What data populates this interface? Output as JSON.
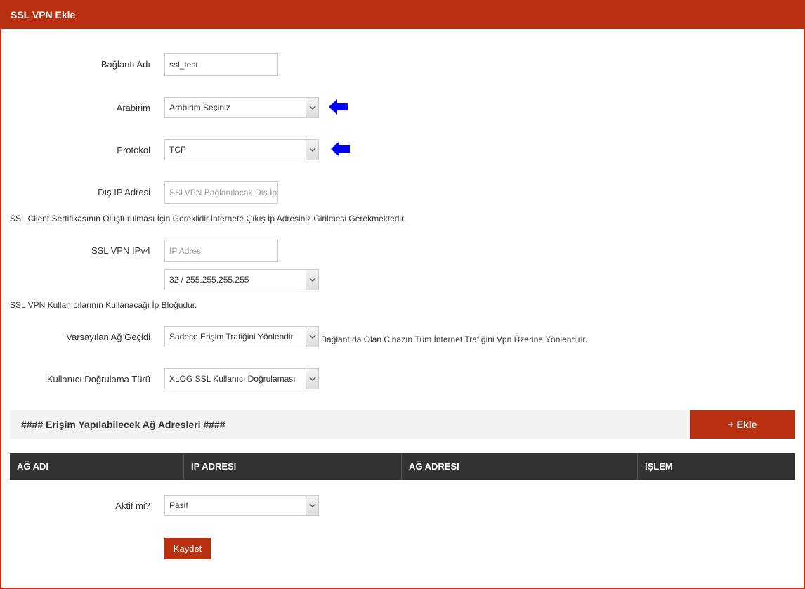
{
  "window": {
    "title": "SSL VPN Ekle"
  },
  "form": {
    "connection_name": {
      "label": "Bağlantı Adı",
      "value": "ssl_test"
    },
    "interface": {
      "label": "Arabirim",
      "selected": "Arabirim Seçiniz"
    },
    "protocol": {
      "label": "Protokol",
      "selected": "TCP"
    },
    "external_ip": {
      "label": "Dış IP Adresi",
      "placeholder": "SSLVPN Bağlanılacak Dış İp Adresi"
    },
    "external_ip_note": "SSL Client Sertifikasının Oluşturulması İçin Gereklidir.İnternete Çıkış İp Adresiniz Girilmesi Gerekmektedir.",
    "ssl_vpn_ipv4": {
      "label": "SSL VPN IPv4",
      "placeholder": "IP Adresi",
      "mask_selected": "32 / 255.255.255.255"
    },
    "ipv4_note": "SSL VPN Kullanıcılarının Kullanacağı İp Bloğudur.",
    "default_gateway": {
      "label": "Varsayılan Ağ Geçidi",
      "selected": "Sadece Erişim Trafiğini Yönlendir",
      "note": "Bağlantıda Olan Cihazın Tüm İnternet Trafiğini Vpn Üzerine Yönlendirir."
    },
    "auth_type": {
      "label": "Kullanıcı Doğrulama Türü",
      "selected": "XLOG SSL Kullanıcı Doğrulaması"
    },
    "active": {
      "label": "Aktif mi?",
      "selected": "Pasif"
    }
  },
  "networks_section": {
    "title": "#### Erişim Yapılabilecek Ağ Adresleri ####",
    "add_label": "+ Ekle",
    "columns": [
      "AĞ ADI",
      "IP ADRESI",
      "AĞ ADRESI",
      "İŞLEM"
    ]
  },
  "actions": {
    "save_label": "Kaydet"
  },
  "colors": {
    "brand": "#b8300f",
    "table_header": "#333333",
    "arrow": "#0000ff"
  },
  "icons": {
    "select_arrow": "chevron-down-icon",
    "pointer": "blue-arrow-left-icon"
  }
}
